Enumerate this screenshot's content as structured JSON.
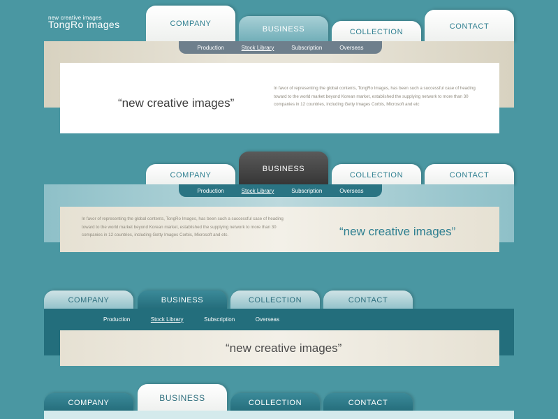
{
  "logo": {
    "tagline": "new creative images",
    "name": "TongRo images"
  },
  "tabs": [
    "COMPANY",
    "BUSINESS",
    "COLLECTION",
    "CONTACT"
  ],
  "submenu": [
    "Production",
    "Stock Library",
    "Subscription",
    "Overseas"
  ],
  "headline": "“new creative images”",
  "paragraph": "In favor of representing the global contents, TongRo Images, has been such a successful case of heading toward to the world market beyond Korean market, established the supplying network to more than 30 companies in 12 countries, including Getty Images Corbis, Microsoft and etc",
  "paragraph2": "In favor of representing the global contents, TongRo Images, has been such a successful case of heading toward to the world market beyond Korean market, established the supplying network to more than 30 companies in 12 countries, including Getty Images Corbis, Microsoft and etc.",
  "colors": {
    "background": "#4a97a2",
    "accent_teal": "#2f7f90",
    "dark_tab": "#3c3c3c"
  }
}
